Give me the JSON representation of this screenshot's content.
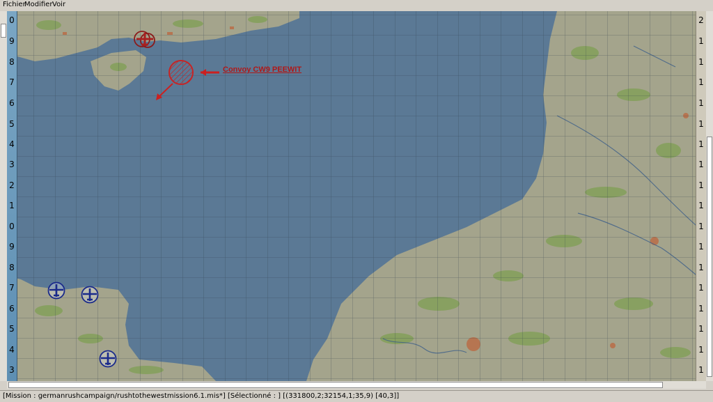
{
  "menu": {
    "items": [
      {
        "label": "Fichier"
      },
      {
        "label": "Modifier"
      },
      {
        "label": "Voir"
      }
    ]
  },
  "map": {
    "left_ruler": [
      "0",
      "9",
      "8",
      "7",
      "6",
      "5",
      "4",
      "3",
      "2",
      "1",
      "0",
      "9",
      "8",
      "7",
      "6",
      "5",
      "4",
      "3"
    ],
    "right_ruler": [
      "2",
      "1",
      "1",
      "1",
      "1",
      "1",
      "1",
      "1",
      "1",
      "1",
      "1",
      "1",
      "1",
      "1",
      "1",
      "1",
      "1",
      "1"
    ],
    "convoy": {
      "label": "Convoy CW9 PEEWIT",
      "color": "#cc2020"
    },
    "units": [
      {
        "icon": "german-aircraft-icon",
        "side": "enemy",
        "color": "#8b1a1a"
      },
      {
        "icon": "british-aircraft-icon",
        "side": "friendly",
        "color": "#1a2a8b"
      },
      {
        "icon": "british-aircraft-icon",
        "side": "friendly",
        "color": "#1a2a8b"
      },
      {
        "icon": "british-aircraft-icon",
        "side": "friendly",
        "color": "#1a2a8b"
      }
    ],
    "colors": {
      "sea": "#5b7995",
      "land": "#a4a48c",
      "forest": "#84a05a",
      "grid": "#2c3a48"
    }
  },
  "status": {
    "text": "[Mission : germanrushcampaign/rushtothewestmission6.1.mis*] [Sélectionné :                          ] [(331800,2;32154,1;35,9) [40,3]]"
  }
}
